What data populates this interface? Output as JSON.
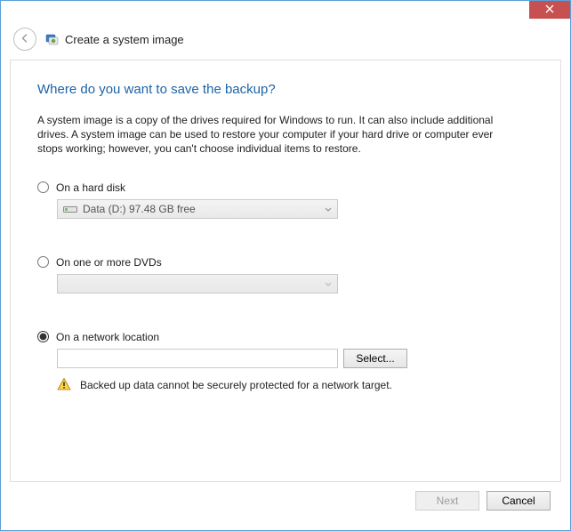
{
  "window": {
    "title": "Create a system image"
  },
  "heading": "Where do you want to save the backup?",
  "description": "A system image is a copy of the drives required for Windows to run. It can also include additional drives. A system image can be used to restore your computer if your hard drive or computer ever stops working; however, you can't choose individual items to restore.",
  "options": {
    "hard_disk": {
      "label": "On a hard disk",
      "selected_drive": "Data (D:)  97.48 GB free",
      "checked": false
    },
    "dvd": {
      "label": "On one or more DVDs",
      "selected": "",
      "checked": false
    },
    "network": {
      "label": "On a network location",
      "value": "",
      "select_button": "Select...",
      "warning": "Backed up data cannot be securely protected for a network target.",
      "checked": true
    }
  },
  "footer": {
    "next": "Next",
    "cancel": "Cancel",
    "next_enabled": false
  }
}
